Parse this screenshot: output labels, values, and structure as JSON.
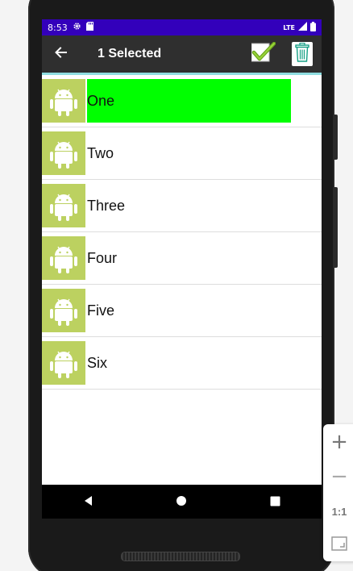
{
  "status_bar": {
    "time": "8:53",
    "network": "LTE",
    "icons": [
      "gear-icon",
      "sd-card-icon",
      "signal-icon",
      "battery-icon"
    ],
    "background": "#3300bb"
  },
  "action_bar": {
    "title": "1 Selected",
    "back_icon": "arrow-back-icon",
    "confirm_icon": "checkmark-icon",
    "delete_icon": "trash-icon",
    "background": "#2f2f2f",
    "accent": "#8fdde0"
  },
  "list": {
    "items": [
      {
        "label": "One",
        "selected": true
      },
      {
        "label": "Two",
        "selected": false
      },
      {
        "label": "Three",
        "selected": false
      },
      {
        "label": "Four",
        "selected": false
      },
      {
        "label": "Five",
        "selected": false
      },
      {
        "label": "Six",
        "selected": false
      }
    ],
    "icon": "android-icon",
    "icon_background": "#bcd160",
    "selected_background": "#00ff00"
  },
  "nav_bar": {
    "buttons": [
      "back-triangle-icon",
      "home-circle-icon",
      "recents-square-icon"
    ]
  },
  "zoom_panel": {
    "zoom_in": "+",
    "zoom_out": "−",
    "actual_size": "1:1",
    "fit_icon": "fit-screen-icon"
  }
}
